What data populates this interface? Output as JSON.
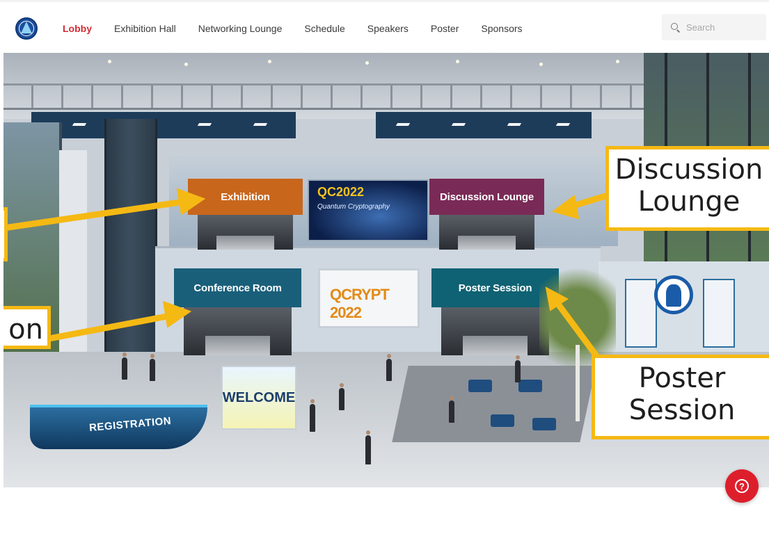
{
  "nav": {
    "items": [
      {
        "label": "Lobby",
        "active": true
      },
      {
        "label": "Exhibition Hall",
        "active": false
      },
      {
        "label": "Networking Lounge",
        "active": false
      },
      {
        "label": "Schedule",
        "active": false
      },
      {
        "label": "Speakers",
        "active": false
      },
      {
        "label": "Poster",
        "active": false
      },
      {
        "label": "Sponsors",
        "active": false
      }
    ],
    "active_color": "#d22c35",
    "logo_icon": "academia-sinica-logo-icon"
  },
  "search": {
    "placeholder": "Search",
    "icon": "search-icon"
  },
  "scene": {
    "booths": [
      {
        "sign": "Exhibition",
        "color": "#c8661c"
      },
      {
        "sign": "Discussion Lounge",
        "color": "#7a2a56"
      },
      {
        "sign": "Conference Room",
        "color": "#1a5f7a"
      },
      {
        "sign": "Poster Session",
        "color": "#0f6273"
      }
    ],
    "screens": {
      "qc_logo": "QC2022",
      "qc_subtitle": "Quantum Cryptography",
      "qrypt_logo": "QCRYPT 2022"
    },
    "welcome_sign": "WELCOME",
    "registration_desk": "REGISTRATION"
  },
  "callouts": {
    "discussion_line1": "Discussion",
    "discussion_line2": "Lounge",
    "poster_line1": "Poster",
    "poster_line2": "Session",
    "conference_fragment": "on",
    "exhibition_fragment": "",
    "border_color": "#f5b914"
  },
  "help": {
    "label": "?",
    "color": "#dd1f2c",
    "icon": "help-circle-icon"
  }
}
